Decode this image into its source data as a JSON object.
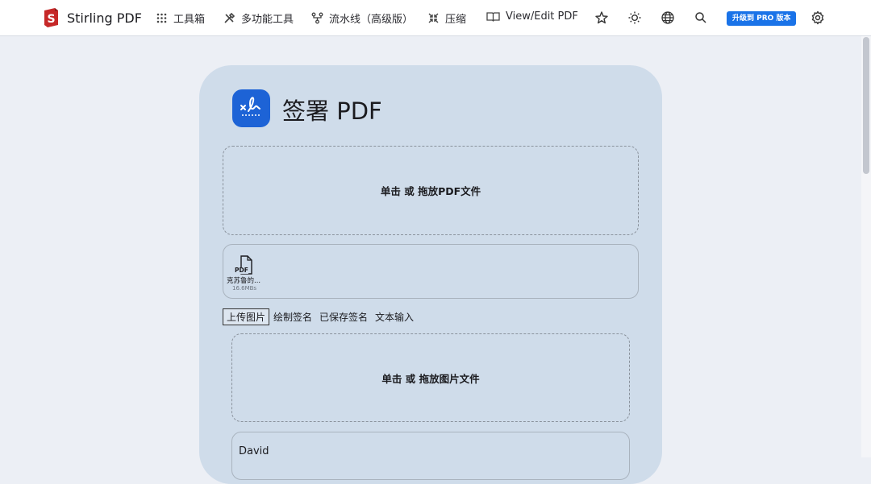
{
  "nav": {
    "brand": "Stirling PDF",
    "items": [
      {
        "label": "工具箱",
        "icon": "grid-icon"
      },
      {
        "label": "多功能工具",
        "icon": "tools-icon"
      },
      {
        "label": "流水线（高级版）",
        "icon": "pipeline-icon"
      },
      {
        "label": "压缩",
        "icon": "compress-icon"
      },
      {
        "label": "View/Edit PDF",
        "icon": "book-icon"
      }
    ],
    "icons": [
      "star-icon",
      "theme-icon",
      "globe-icon",
      "search-icon",
      "gear-icon"
    ],
    "pro_button": "升级到 PRO 版本"
  },
  "tool": {
    "title": "签署 PDF",
    "pdf_dropzone": "单击 或 拖放PDF文件",
    "file": {
      "badge": "PDF",
      "name": "克苏鲁的...",
      "size": "16.6MBs"
    },
    "tabs": [
      "上传图片",
      "绘制签名",
      "已保存签名",
      "文本输入"
    ],
    "image_dropzone": "单击 或 拖放图片文件",
    "text_value": "David"
  },
  "colors": {
    "accent": "#1d63d6",
    "pro": "#1a73e8",
    "card": "#cfdcea",
    "brand_red": "#c62828"
  }
}
